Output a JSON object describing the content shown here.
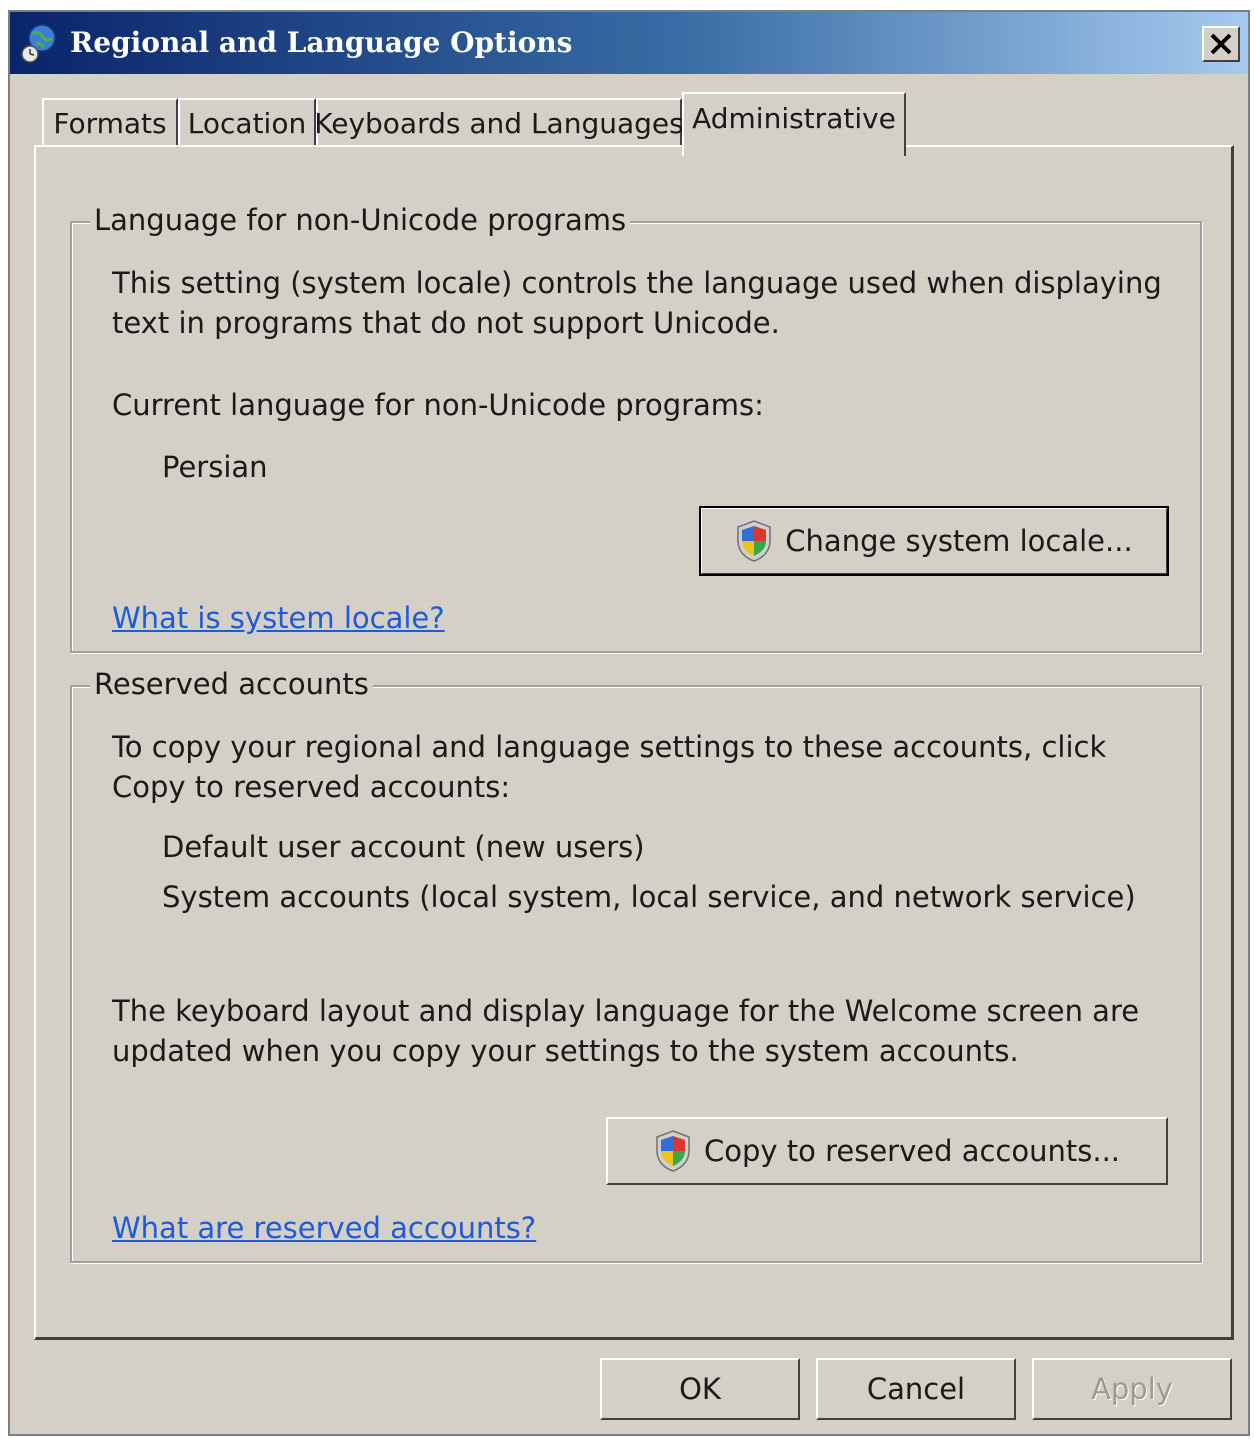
{
  "window": {
    "title": "Regional and Language Options",
    "close_label": "✕"
  },
  "tabs": [
    {
      "label": "Formats",
      "active": false
    },
    {
      "label": "Location",
      "active": false
    },
    {
      "label": "Keyboards and Languages",
      "active": false
    },
    {
      "label": "Administrative",
      "active": true
    }
  ],
  "non_unicode": {
    "group_title": "Language for non-Unicode programs",
    "description_line1": "This setting (system locale) controls the language used when displaying",
    "description_line2": "text in programs that do not support Unicode.",
    "current_label": "Current language for non-Unicode programs:",
    "current_value": "Persian",
    "change_button": "Change system locale...",
    "help_link": "What is system locale?"
  },
  "reserved": {
    "group_title": "Reserved accounts",
    "description_line1": "To copy your regional and language settings to these accounts, click",
    "description_line2": "Copy to reserved accounts:",
    "accounts": [
      "Default user account (new users)",
      "System accounts (local system, local service, and network service)"
    ],
    "note_line1": "The keyboard layout and display language for the Welcome screen are",
    "note_line2": "updated when you copy your settings to the system accounts.",
    "copy_button": "Copy to reserved accounts...",
    "help_link": "What are reserved accounts?"
  },
  "footer": {
    "ok": "OK",
    "cancel": "Cancel",
    "apply": "Apply"
  },
  "colors": {
    "dialog_bg": "#d4d0c8",
    "title_gradient_start": "#0a246a",
    "title_gradient_end": "#a6caf0",
    "link": "#1e5bd6"
  }
}
